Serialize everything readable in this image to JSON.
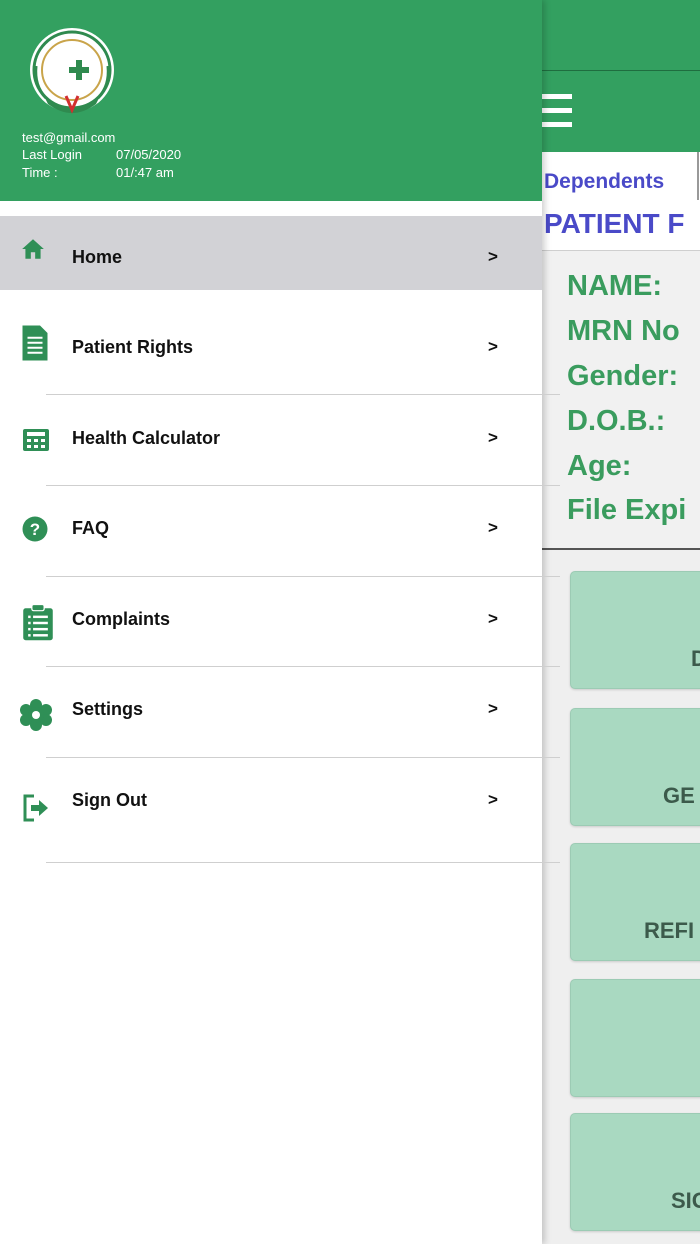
{
  "drawer": {
    "email": "test@gmail.com",
    "last_login_label": "Last Login",
    "last_login_value": "07/05/2020",
    "time_label": "Time :",
    "time_value": "01/:47 am",
    "items": [
      {
        "label": "Home",
        "arrow": ">",
        "icon": "home-icon",
        "active": true
      },
      {
        "label": "Patient Rights",
        "arrow": ">",
        "icon": "document-icon"
      },
      {
        "label": "Health Calculator",
        "arrow": ">",
        "icon": "calculator-icon"
      },
      {
        "label": "FAQ",
        "arrow": ">",
        "icon": "question-icon"
      },
      {
        "label": "Complaints",
        "arrow": ">",
        "icon": "clipboard-list-icon"
      },
      {
        "label": "Settings",
        "arrow": ">",
        "icon": "gear-flower-icon"
      },
      {
        "label": "Sign Out",
        "arrow": ">",
        "icon": "sign-out-icon"
      }
    ]
  },
  "main": {
    "tab_dependents": "Dependents",
    "section_title": "PATIENT F",
    "info_lines": [
      "NAME:",
      "MRN No",
      "Gender:",
      "D.O.B.:",
      "Age:",
      "File Expi"
    ],
    "tiles": [
      "D",
      "GE",
      "REFI",
      "",
      "SIG"
    ]
  },
  "colors": {
    "brand_green": "#33a060",
    "accent_blue": "#4a4ac8",
    "tile_green": "#a9d9c1",
    "active_row": "#d2d2d6"
  }
}
